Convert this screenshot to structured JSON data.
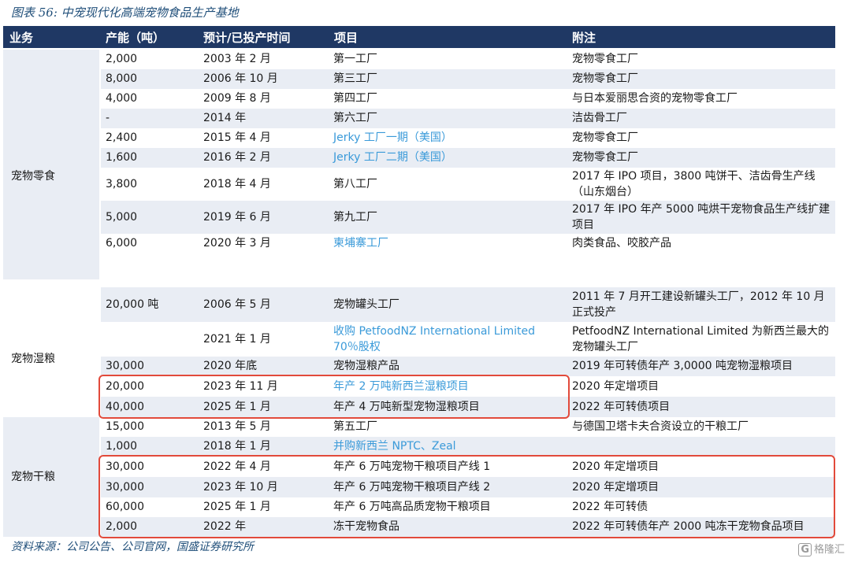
{
  "title": "图表 56: 中宠现代化高端宠物食品生产基地",
  "headers": [
    "业务",
    "产能（吨）",
    "预计/已投产时间",
    "项目",
    "附注"
  ],
  "groups": {
    "snacks": "宠物零食",
    "wet": "宠物湿粮",
    "dry": "宠物干粮"
  },
  "rows": [
    {
      "cap": "2,000",
      "time": "2003 年 2 月",
      "project": "第一工厂",
      "note": "宠物零食工厂"
    },
    {
      "cap": "8,000",
      "time": "2006 年 10 月",
      "project": "第三工厂",
      "note": "宠物零食工厂"
    },
    {
      "cap": "4,000",
      "time": "2009 年 8 月",
      "project": "第四工厂",
      "note": "与日本爱丽思合资的宠物零食工厂"
    },
    {
      "cap": "-",
      "time": "2014 年",
      "project": "第六工厂",
      "note": "洁齿骨工厂"
    },
    {
      "cap": "2,400",
      "time": "2015 年 4 月",
      "project": "Jerky 工厂一期（美国）",
      "note": "宠物零食工厂"
    },
    {
      "cap": "1,600",
      "time": "2016 年 2 月",
      "project": "Jerky 工厂二期（美国）",
      "note": "宠物零食工厂"
    },
    {
      "cap": "3,800",
      "time": "2018 年 4 月",
      "project": "第八工厂",
      "note": "2017 年 IPO 项目，3800 吨饼干、洁齿骨生产线（山东烟台）"
    },
    {
      "cap": "5,000",
      "time": "2019 年 6 月",
      "project": "第九工厂",
      "note": "2017 年 IPO 年产 5000 吨烘干宠物食品生产线扩建项目"
    },
    {
      "cap": "6,000",
      "time": "2020 年 3 月",
      "project": "柬埔寨工厂",
      "note": "肉类食品、咬胶产品"
    },
    {
      "cap": "20,000 吨",
      "time": "2006 年 5 月",
      "project": "宠物罐头工厂",
      "note": "2011 年 7 月开工建设新罐头工厂，2012 年 10 月正式投产"
    },
    {
      "cap": "",
      "time": "2021 年 1 月",
      "project": "收购 PetfoodNZ International Limited 70％股权",
      "note": "PetfoodNZ International Limited 为新西兰最大的宠物罐头工厂"
    },
    {
      "cap": "30,000",
      "time": "2020 年底",
      "project": "宠物湿粮产品",
      "note": "2019 年可转债年产 3,0000 吨宠物湿粮项目"
    },
    {
      "cap": "20,000",
      "time": "2023 年 11 月",
      "project": "年产 2 万吨新西兰湿粮项目",
      "note": "2020 年定增项目"
    },
    {
      "cap": "40,000",
      "time": "2025 年 1 月",
      "project": "年产 4 万吨新型宠物湿粮项目",
      "note": "2022 年可转债项目"
    },
    {
      "cap": "15,000",
      "time": "2013 年 5 月",
      "project": "第五工厂",
      "note": "与德国卫塔卡夫合资设立的干粮工厂"
    },
    {
      "cap": "1,000",
      "time": "2018 年 1 月",
      "project": "并购新西兰 NPTC、Zeal",
      "note": ""
    },
    {
      "cap": "30,000",
      "time": "2022 年 4 月",
      "project": "年产 6 万吨宠物干粮项目产线 1",
      "note": "2020 年定增项目"
    },
    {
      "cap": "30,000",
      "time": "2023 年 10 月",
      "project": "年产 6 万吨宠物干粮项目产线 2",
      "note": "2020 年定增项目"
    },
    {
      "cap": "60,000",
      "time": "2025 年 1 月",
      "project": "年产 6 万吨高品质宠物干粮项目",
      "note": "2022 年可转债"
    },
    {
      "cap": "2,000",
      "time": "2022 年",
      "project": "冻干宠物食品",
      "note": "2022 年可转债年产 2000 吨冻干宠物食品项目"
    }
  ],
  "source": "资料来源：公司公告、公司官网，国盛证券研究所",
  "logo": "格隆汇",
  "colors": {
    "header_bg": "#1f3864",
    "shade": "#e9edf4",
    "link": "#3a9ad9",
    "highlight_box": "#e24a3b"
  }
}
